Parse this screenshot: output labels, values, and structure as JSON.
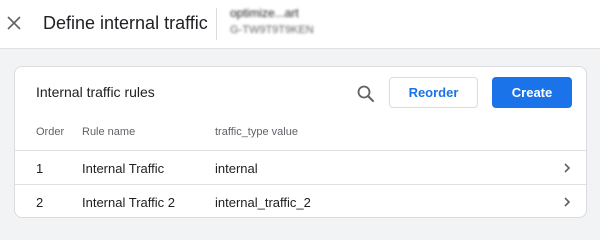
{
  "header": {
    "title": "Define internal traffic",
    "property_name": "optimize...art",
    "property_id": "G-TW9T9T9KEN"
  },
  "icons": {
    "close": "close-icon",
    "search": "search-icon",
    "row_chevron": "chevron-right-icon"
  },
  "card": {
    "title": "Internal traffic rules",
    "reorder_label": "Reorder",
    "create_label": "Create"
  },
  "table": {
    "columns": [
      "Order",
      "Rule name",
      "traffic_type value"
    ],
    "rows": [
      {
        "order": "1",
        "name": "Internal Traffic",
        "value": "internal"
      },
      {
        "order": "2",
        "name": "Internal Traffic 2",
        "value": "internal_traffic_2"
      }
    ]
  },
  "colors": {
    "accent": "#1a73e8",
    "background": "#f1f3f4"
  }
}
